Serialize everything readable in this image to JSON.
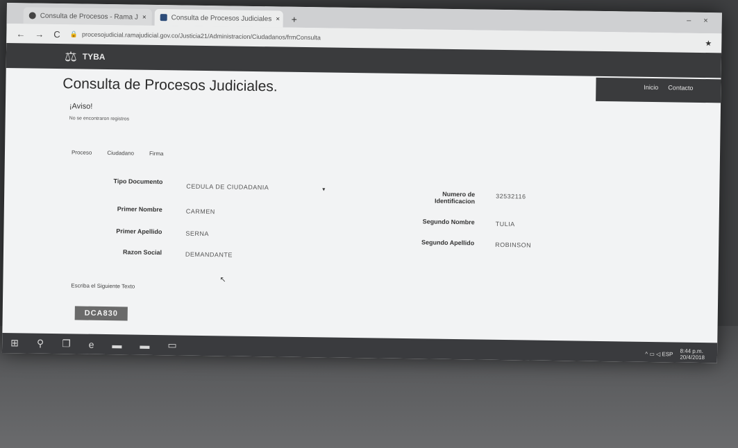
{
  "browser": {
    "tabs": [
      {
        "label": "Consulta de Procesos - Rama J",
        "close": "×"
      },
      {
        "label": "Consulta de Procesos Judiciales",
        "close": "×"
      }
    ],
    "new_tab": "+",
    "nav_back": "←",
    "nav_forward": "→",
    "nav_reload": "C",
    "url": "procesojudicial.ramajudicial.gov.co/Justicia21/Administracion/Ciudadanos/frmConsulta",
    "star": "★",
    "window_min": "–",
    "window_close": "×"
  },
  "site": {
    "logo_icon": "⚖",
    "logo_text": "TYBA",
    "nav": [
      "Inicio",
      "Contacto"
    ]
  },
  "page": {
    "title": "Consulta de Procesos Judiciales.",
    "alert_title": "¡Aviso!",
    "alert_msg": "No se encontraron registros",
    "radio_tabs": [
      "Proceso",
      "Ciudadano",
      "Firma"
    ]
  },
  "form": {
    "tipo_documento_label": "Tipo Documento",
    "tipo_documento_value": "CEDULA DE CIUDADANIA",
    "numero_label_1": "Numero de",
    "numero_label_2": "Identificacion",
    "numero_value": "32532116",
    "primer_nombre_label": "Primer Nombre",
    "primer_nombre_value": "CARMEN",
    "segundo_nombre_label": "Segundo Nombre",
    "segundo_nombre_value": "TULIA",
    "primer_apellido_label": "Primer Apellido",
    "primer_apellido_value": "SERNA",
    "segundo_apellido_label": "Segundo Apellido",
    "segundo_apellido_value": "ROBINSON",
    "razon_social_label": "Razon Social",
    "razon_social_value": "DEMANDANTE",
    "captcha_label": "Escriba el Siguiente Texto",
    "captcha_value": "DCA830"
  },
  "taskbar": {
    "icons": [
      "windows-icon",
      "search-icon",
      "task-view-icon",
      "edge-icon",
      "folder-icon",
      "store-icon",
      "app-icon"
    ],
    "glyphs": [
      "⊞",
      "⚲",
      "❐",
      "e",
      "▬",
      "▬",
      "▭"
    ],
    "tray_text": "^ ▭ ◁ ESP",
    "clock": "8:44 p.m.",
    "date": "20/4/2018"
  }
}
